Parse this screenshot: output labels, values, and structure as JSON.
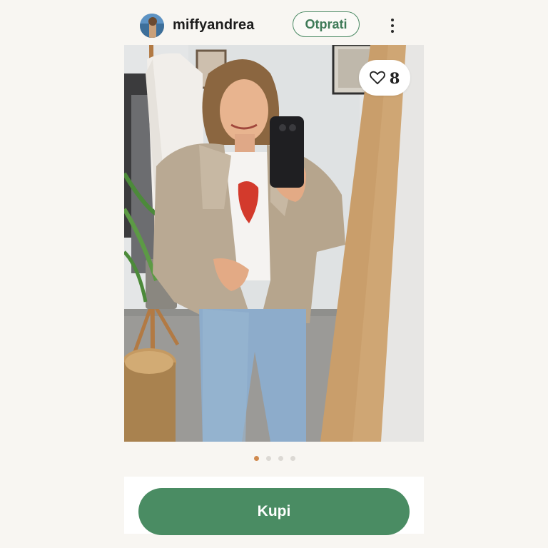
{
  "header": {
    "username": "miffyandrea",
    "follow_label": "Otprati",
    "avatar_icon": "user-avatar",
    "more_icon": "more-vertical-icon"
  },
  "photo": {
    "likes": "8",
    "like_icon": "heart-outline-icon"
  },
  "pagination": {
    "total": 4,
    "active_index": 0,
    "active_color": "#d08a4f",
    "inactive_color": "#dcd9d4"
  },
  "actions": {
    "buy_label": "Kupi",
    "buy_color": "#4a8c63"
  },
  "colors": {
    "accent_green": "#4b8a64",
    "background": "#f8f6f2"
  }
}
